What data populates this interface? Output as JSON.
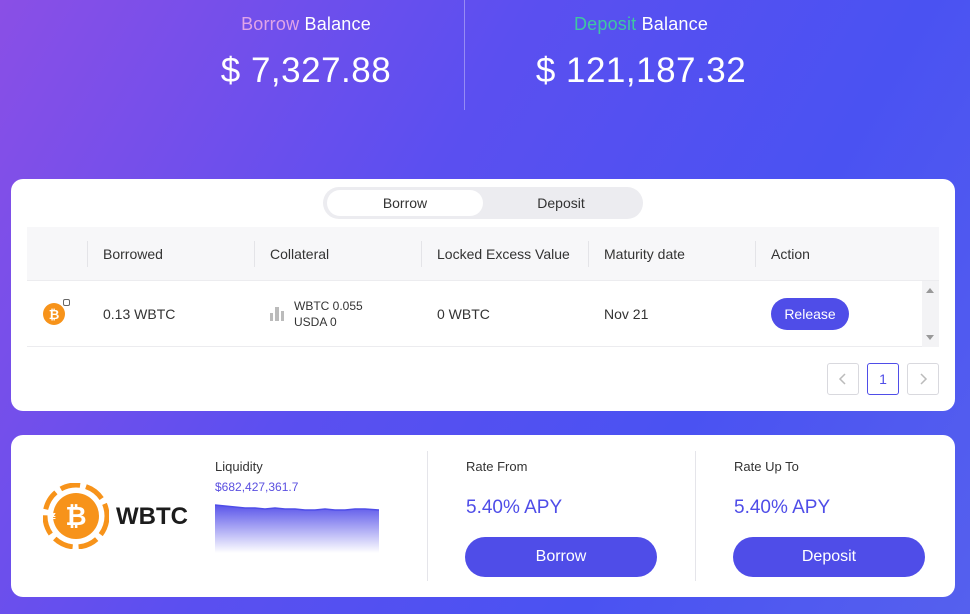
{
  "header": {
    "borrow_balance": {
      "label_highlight": "Borrow",
      "label_rest": " Balance",
      "amount": "$ 7,327.88"
    },
    "deposit_balance": {
      "label_highlight": "Deposit",
      "label_rest": " Balance",
      "amount": "$ 121,187.32"
    }
  },
  "positions": {
    "tabs": [
      {
        "label": "Borrow",
        "active": true
      },
      {
        "label": "Deposit",
        "active": false
      }
    ],
    "columns": [
      "Borrowed",
      "Collateral",
      "Locked Excess Value",
      "Maturity date",
      "Action"
    ],
    "rows": [
      {
        "asset_icon": "bitcoin-locked-icon",
        "borrowed": "0.13 WBTC",
        "collateral_line1": "WBTC 0.055",
        "collateral_line2": "USDA 0",
        "locked_excess_value": "0 WBTC",
        "maturity_date": "Nov 21",
        "action_label": "Release"
      }
    ],
    "pagination": {
      "current_page": "1",
      "prev_icon": "chevron-left-icon",
      "next_icon": "chevron-right-icon"
    }
  },
  "market": {
    "coin_name": "WBTC",
    "liquidity_label": "Liquidity",
    "liquidity_value": "$682,427,361.7",
    "rate_from_label": "Rate From",
    "rate_from_value": "5.40% APY",
    "rate_up_to_label": "Rate Up To",
    "rate_up_to_value": "5.40% APY",
    "borrow_button": "Borrow",
    "deposit_button": "Deposit"
  },
  "colors": {
    "accent": "#4f4de8",
    "borrow_highlight": "#e0a4e8",
    "deposit_highlight": "#3fc7a0",
    "bitcoin_orange": "#f7931a"
  }
}
